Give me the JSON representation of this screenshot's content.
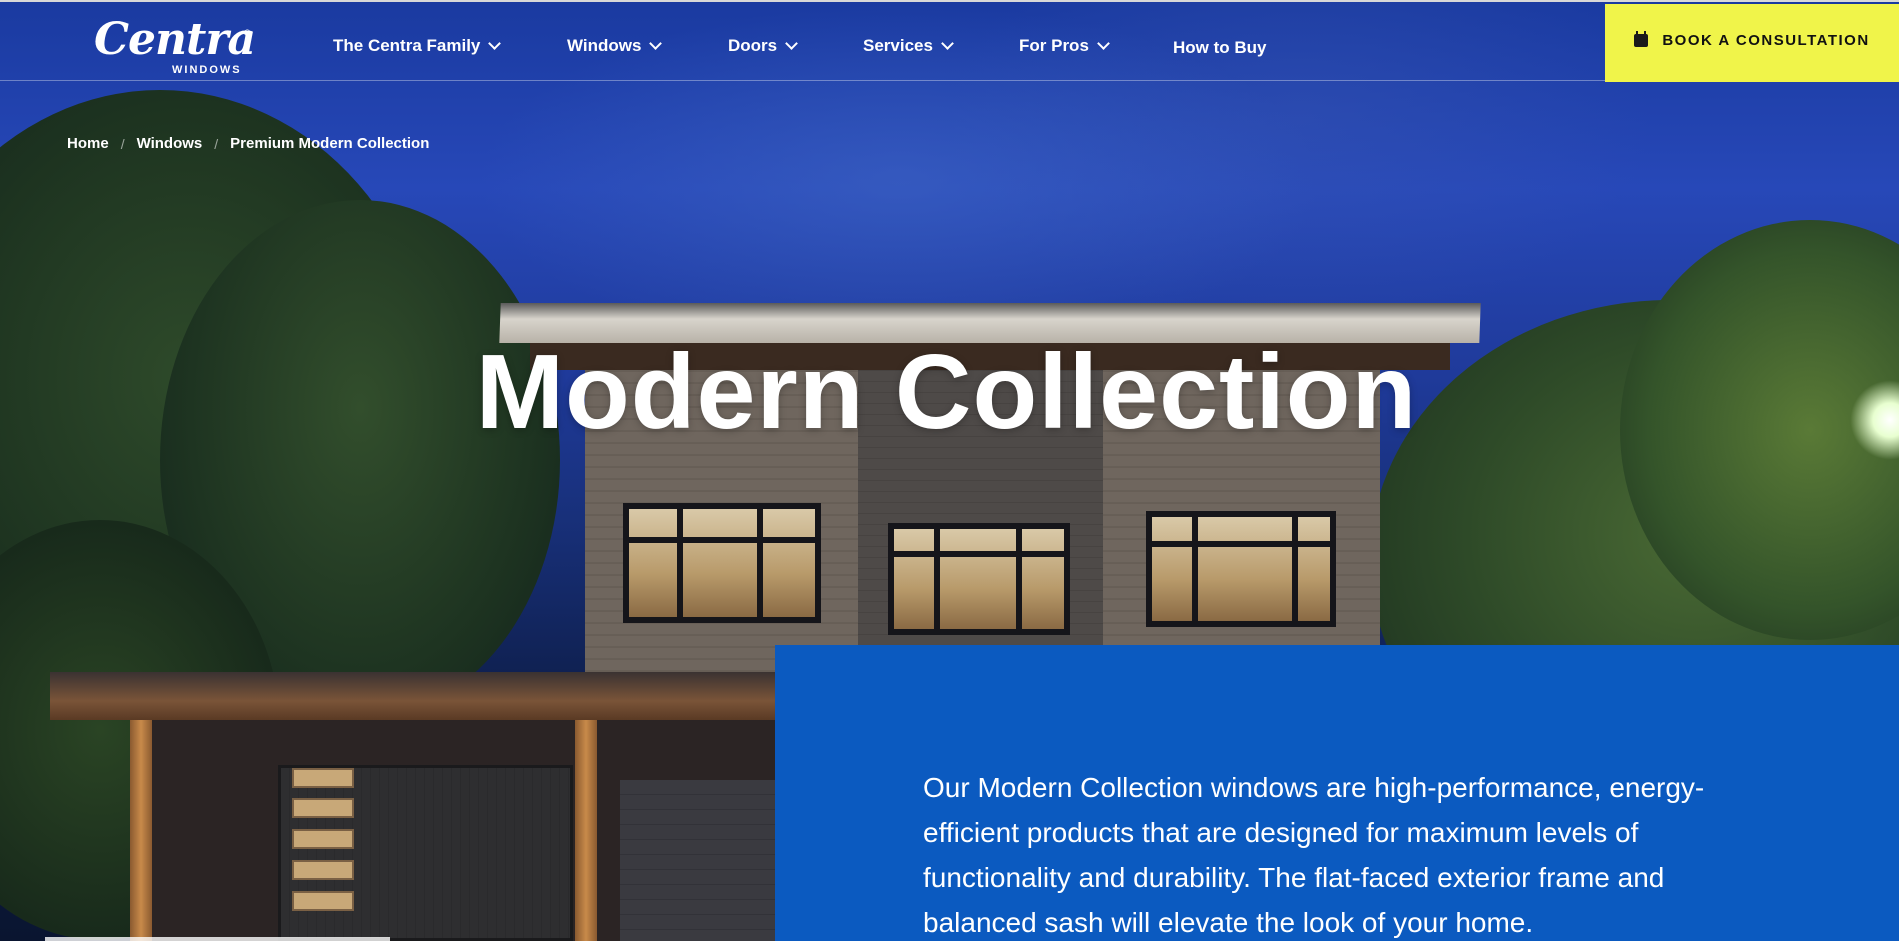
{
  "brand": {
    "logo_word": "Centra",
    "logo_sub": "WINDOWS",
    "logo_reg": "®"
  },
  "nav": {
    "items": [
      {
        "label": "The Centra Family",
        "dropdown": true
      },
      {
        "label": "Windows",
        "dropdown": true
      },
      {
        "label": "Doors",
        "dropdown": true
      },
      {
        "label": "Services",
        "dropdown": true
      },
      {
        "label": "For Pros",
        "dropdown": true
      },
      {
        "label": "How to Buy",
        "dropdown": false
      }
    ],
    "cta_label": "BOOK A CONSULTATION",
    "cta_icon": "calendar-icon",
    "cta_color": "#f0f44a"
  },
  "breadcrumb": {
    "items": [
      "Home",
      "Windows",
      "Premium Modern Collection"
    ],
    "separator": "/"
  },
  "hero": {
    "title": "Modern Collection"
  },
  "info": {
    "text": "Our Modern Collection windows are high-performance, energy-efficient products that are designed for maximum levels of functionality and durability. The flat-faced exterior frame and balanced sash will elevate the look of your home.",
    "panel_color": "#0b5ac0"
  }
}
